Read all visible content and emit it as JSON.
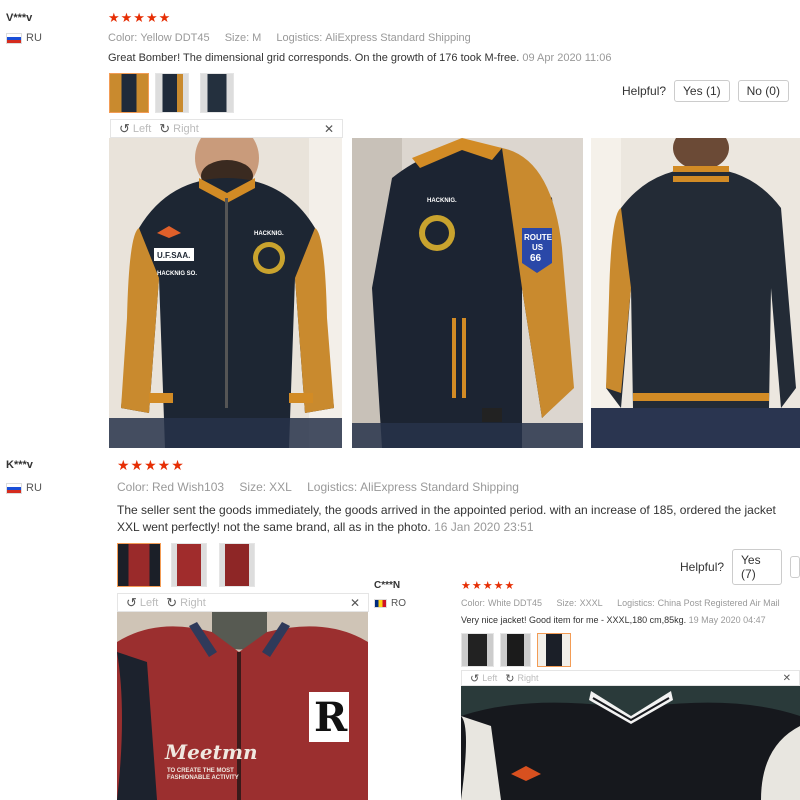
{
  "reviews": [
    {
      "user": "V***v",
      "country": "RU",
      "stars": "★★★★★",
      "color_label": "Color:",
      "color": "Yellow DDT45",
      "size_label": "Size:",
      "size": "M",
      "logistics_label": "Logistics:",
      "logistics": "AliExpress Standard Shipping",
      "text": "Great Bomber! The dimensional grid corresponds. On the growth of 176 took M-free.",
      "date": "09 Apr 2020 11:06",
      "helpful_label": "Helpful?",
      "yes": "Yes (1)",
      "no": "No (0)",
      "left": "Left",
      "right": "Right"
    },
    {
      "user": "K***v",
      "country": "RU",
      "stars": "★★★★★",
      "color_label": "Color:",
      "color": "Red Wish103",
      "size_label": "Size:",
      "size": "XXL",
      "logistics_label": "Logistics:",
      "logistics": "AliExpress Standard Shipping",
      "text": "The seller sent the goods immediately, the goods arrived in the appointed period. with an increase of 185, ordered the jacket XXL went perfectly! not the same brand, all as in the photo.",
      "date": "16 Jan 2020 23:51",
      "helpful_label": "Helpful?",
      "yes": "Yes (7)",
      "left": "Left",
      "right": "Right"
    },
    {
      "user": "C***N",
      "country": "RO",
      "stars": "★★★★★",
      "color_label": "Color:",
      "color": "White DDT45",
      "size_label": "Size:",
      "size": "XXXL",
      "logistics_label": "Logistics:",
      "logistics": "China Post Registered Air Mail",
      "text": "Very nice jacket! Good item for me - XXXL,180 cm,85kg.",
      "date": "19 May 2020 04:47",
      "left": "Left",
      "right": "Right"
    }
  ],
  "photo_text": {
    "ufsaa": "U.F.SAA.",
    "hacknig": "HACKNIG.",
    "hacknig_so": "HACKNIG SO.",
    "route": "ROUTE",
    "us": "US",
    "num": "66",
    "r_letter": "R",
    "meetmn": "Meetmn",
    "meetmn_sub": "TO CREATE THE MOST FASHIONABLE ACTIVITY"
  }
}
